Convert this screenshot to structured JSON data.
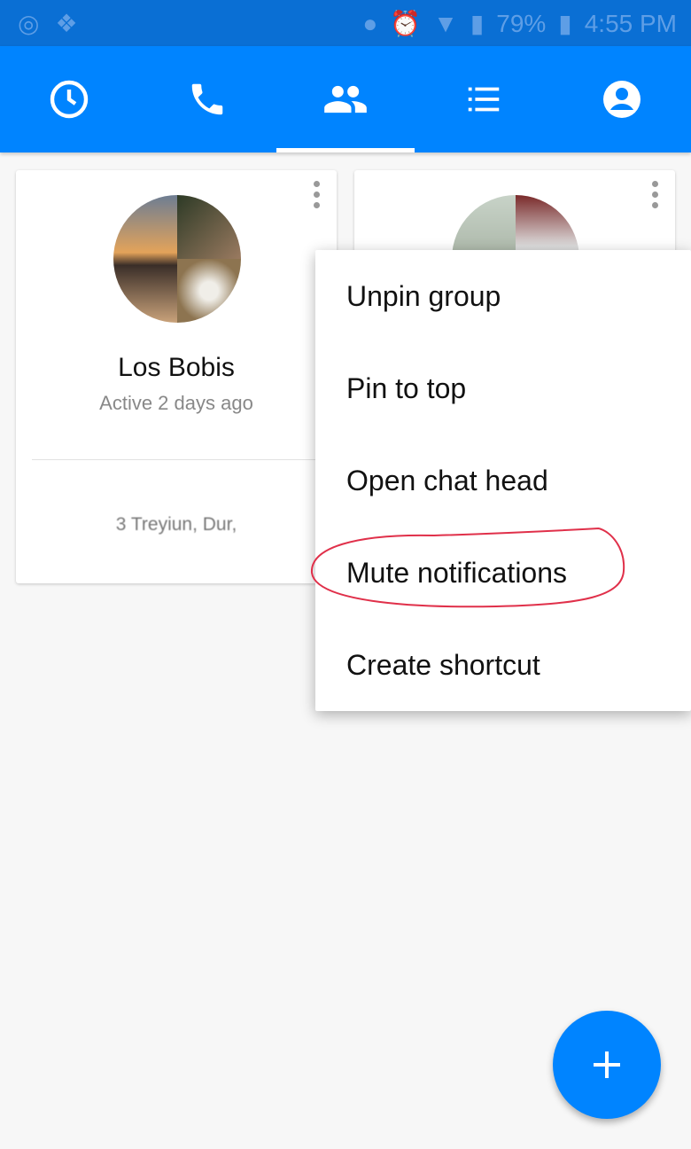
{
  "status_bar": {
    "battery": "79%",
    "time": "4:55 PM",
    "icons": [
      "whatsapp-icon",
      "dropbox-icon",
      "location-icon",
      "alarm-icon",
      "wifi-icon",
      "signal-icon",
      "battery-icon"
    ]
  },
  "tabs": [
    {
      "icon": "clock-icon"
    },
    {
      "icon": "phone-icon"
    },
    {
      "icon": "groups-icon",
      "active": true
    },
    {
      "icon": "list-icon"
    },
    {
      "icon": "profile-icon"
    }
  ],
  "groups": [
    {
      "name": "Los Bobis",
      "status": "Active 2 days ago",
      "members": "3 Treyiun, Dur,"
    }
  ],
  "menu": {
    "items": [
      "Unpin group",
      "Pin to top",
      "Open chat head",
      "Mute notifications",
      "Create shortcut"
    ],
    "highlighted": "Mute notifications"
  },
  "colors": {
    "accent": "#0084ff",
    "status_bar": "#0a6fd4",
    "annotation": "#e0304a"
  }
}
